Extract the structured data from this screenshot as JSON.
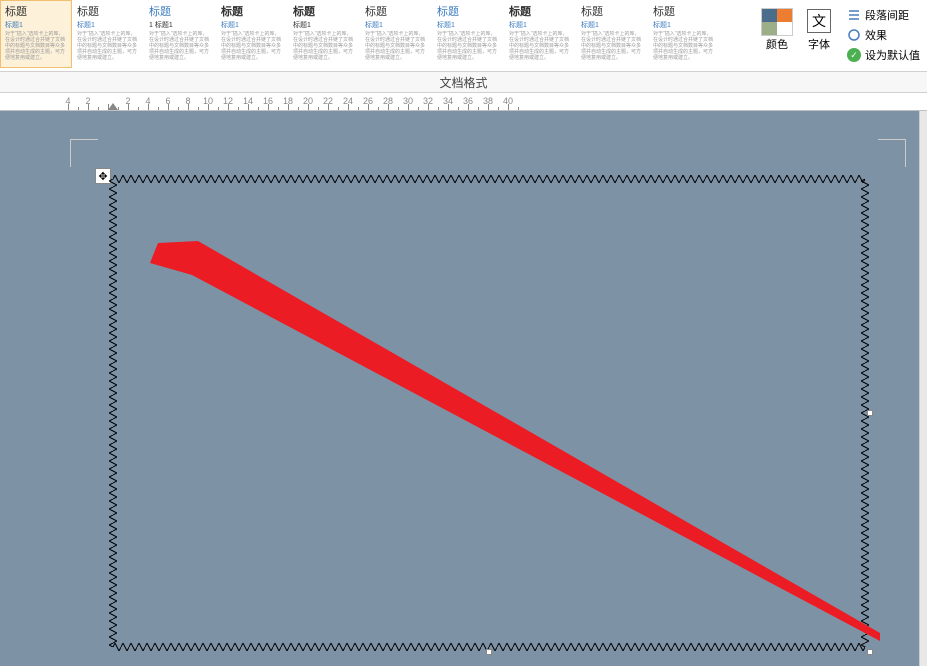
{
  "ribbon": {
    "styles": [
      {
        "title": "标题",
        "subtitle": "标题1",
        "titleClass": "",
        "subtitleClass": ""
      },
      {
        "title": "标题",
        "subtitle": "标题1",
        "titleClass": "serif",
        "subtitleClass": ""
      },
      {
        "title": "标题",
        "subtitle": "1 标题1",
        "titleClass": "blue",
        "subtitleClass": "dark"
      },
      {
        "title": "标题",
        "subtitle": "标题1",
        "titleClass": "serif bold",
        "subtitleClass": ""
      },
      {
        "title": "标题",
        "subtitle": "标题1",
        "titleClass": "bold",
        "subtitleClass": "dark"
      },
      {
        "title": "标题",
        "subtitle": "标题1",
        "titleClass": "serif",
        "subtitleClass": ""
      },
      {
        "title": "标题",
        "subtitle": "标题1",
        "titleClass": "blue",
        "subtitleClass": ""
      },
      {
        "title": "标题",
        "subtitle": "标题1",
        "titleClass": "serif bold",
        "subtitleClass": ""
      },
      {
        "title": "标题",
        "subtitle": "标题1",
        "titleClass": "serif",
        "subtitleClass": ""
      },
      {
        "title": "标题",
        "subtitle": "标题1",
        "titleClass": "serif",
        "subtitleClass": ""
      }
    ],
    "stylePreviewText": "对于\"插入\"选项卡上的库，在设计时通过合并链了文档中的标题与文档数目等众多项并自动生成的主题，可方便地复用或建立。",
    "colorLabel": "颜色",
    "fontLabel": "字体",
    "fontIcon": "文",
    "options": {
      "paragraphSpacing": "段落间距",
      "effects": "效果",
      "setDefault": "设为默认值"
    }
  },
  "formatRow": {
    "label": "文档格式"
  },
  "ruler": {
    "ticks": [
      4,
      2,
      "",
      2,
      4,
      6,
      8,
      10,
      12,
      14,
      16,
      18,
      20,
      22,
      24,
      26,
      28,
      30,
      32,
      34,
      36,
      38,
      40
    ]
  },
  "moveHandleGlyph": "✥"
}
